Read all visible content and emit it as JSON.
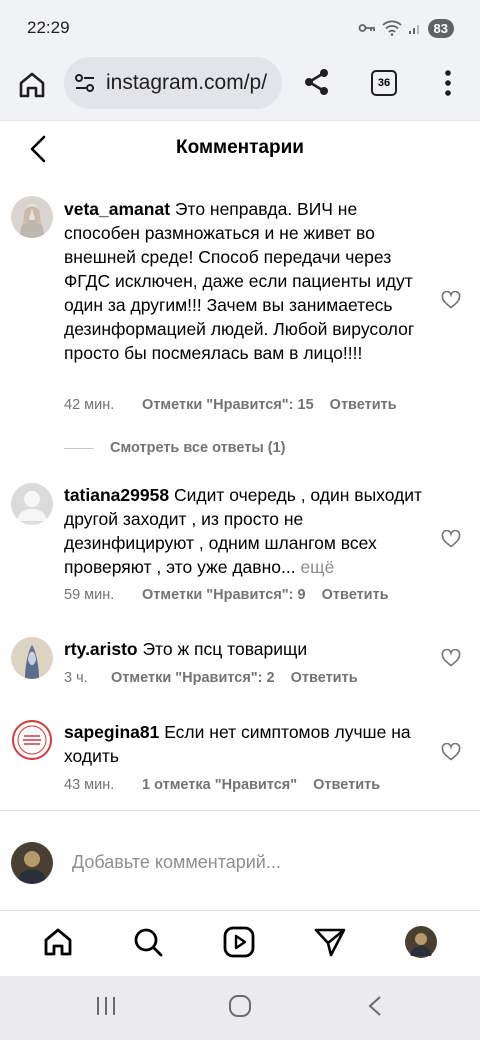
{
  "status_bar": {
    "time": "22:29",
    "battery": "83"
  },
  "browser": {
    "url": "instagram.com/p/",
    "tab_count": "36"
  },
  "header": {
    "title": "Комментарии"
  },
  "comments": [
    {
      "username": "veta_amanat",
      "text": "Это неправда. ВИЧ не способен размножаться и не живет во внешней среде! Способ передачи через ФГДС исключен, даже если пациенты идут один за другим!!! Зачем вы занимаетесь дезинформацией людей. Любой вирусолог просто бы посмеялась вам в лицо!!!!",
      "time": "42 мин.",
      "likes": "Отметки \"Нравится\": 15",
      "reply": "Ответить",
      "view_replies": "Смотреть все ответы (1)"
    },
    {
      "username": "tatiana29958",
      "text": "Сидит очередь , один выходит другой заходит , из просто не дезинфицируют , одним шлангом всех проверяют , это уже давно...",
      "more": "ещё",
      "time": "59 мин.",
      "likes": "Отметки \"Нравится\": 9",
      "reply": "Ответить"
    },
    {
      "username": "rty.aristo",
      "text": "Это ж псц товарищи",
      "time": "3 ч.",
      "likes": "Отметки \"Нравится\": 2",
      "reply": "Ответить"
    },
    {
      "username": "sapegina81",
      "text": "Если нет симптомов лучше на ходить",
      "time": "43 мин.",
      "likes": "1 отметка \"Нравится\"",
      "reply": "Ответить"
    }
  ],
  "add_comment": {
    "placeholder": "Добавьте комментарий..."
  },
  "icons": {
    "browser": [
      "home-icon",
      "site-settings-icon",
      "share-icon",
      "tabs-icon",
      "menu-icon"
    ],
    "nav": [
      "home-icon",
      "search-icon",
      "reels-icon",
      "direct-icon",
      "profile-icon"
    ],
    "system": [
      "recents-icon",
      "home-circle-icon",
      "back-icon"
    ]
  },
  "colors": {
    "secondary_text": "#737373",
    "browser_bar": "#f1f2f6",
    "system_bar": "#ebebef"
  }
}
